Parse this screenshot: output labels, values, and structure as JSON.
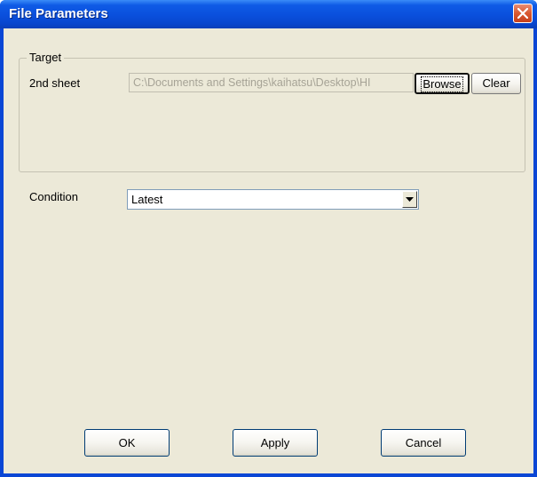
{
  "window": {
    "title": "File Parameters"
  },
  "target": {
    "group_label": "Target",
    "sheet_label": "2nd sheet",
    "path_value": "C:\\Documents and Settings\\kaihatsu\\Desktop\\HI",
    "browse_label": "Browse",
    "clear_label": "Clear"
  },
  "condition": {
    "label": "Condition",
    "selected": "Latest"
  },
  "footer": {
    "ok_label": "OK",
    "apply_label": "Apply",
    "cancel_label": "Cancel"
  },
  "icons": {
    "close": "close-icon",
    "dropdown": "chevron-down-icon"
  },
  "colors": {
    "titlebar": "#0a4fdc",
    "dialog_bg": "#ece9d8",
    "close_button": "#d9582f"
  }
}
